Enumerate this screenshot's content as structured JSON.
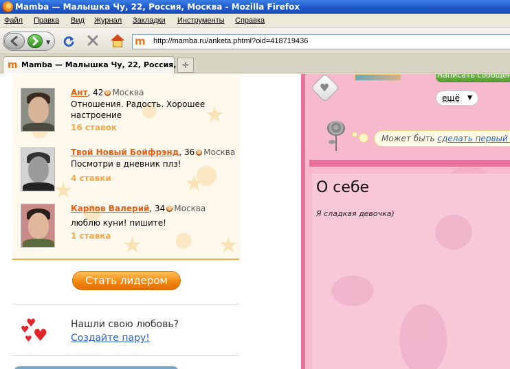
{
  "window": {
    "title": "Mamba — Малышка Чу, 22, Россия, Москва - Mozilla Firefox"
  },
  "menu": [
    "Файл",
    "Правка",
    "Вид",
    "Журнал",
    "Закладки",
    "Инструменты",
    "Справка"
  ],
  "toolbar": {
    "url": "http://mamba.ru/anketa.phtml?oid=418719436",
    "favicon": "m"
  },
  "tabs": [
    {
      "title": "Mamba — Малышка Чу, 22, Россия, ...",
      "favicon": "m"
    }
  ],
  "new_tab_symbol": "✛",
  "leaders": [
    {
      "name": "Ант",
      "age": ", 42",
      "city": "Москва",
      "status": "Отношения. Радость. Хорошее настроение",
      "bids": "16 ставок"
    },
    {
      "name": "Твой Новый Бойфрэнд",
      "age": ", 36",
      "city": "Москва",
      "status": "Посмотри в дневник плз!",
      "bids": "4 ставки"
    },
    {
      "name": "Карпов Валерий",
      "age": ", 34",
      "city": "Москва",
      "status": "люблю куни! пишите!",
      "bids": "1 ставка"
    }
  ],
  "leader_button": "Стать лидером",
  "love": {
    "title": "Нашли свою любовь?",
    "link": "Создайте пару!"
  },
  "profile": {
    "more_button": "ещё",
    "bubble_text": "Может быть ",
    "bubble_link": "сделать первый к",
    "green_button": "Написать сообщени",
    "about_title": "О себе",
    "about_text": "Я сладкая девочка)"
  },
  "colors": {
    "accent_orange": "#e0621a",
    "link_blue": "#2a62c8",
    "pink_bg": "#f6b9cd",
    "pink_border": "#e8729b"
  }
}
